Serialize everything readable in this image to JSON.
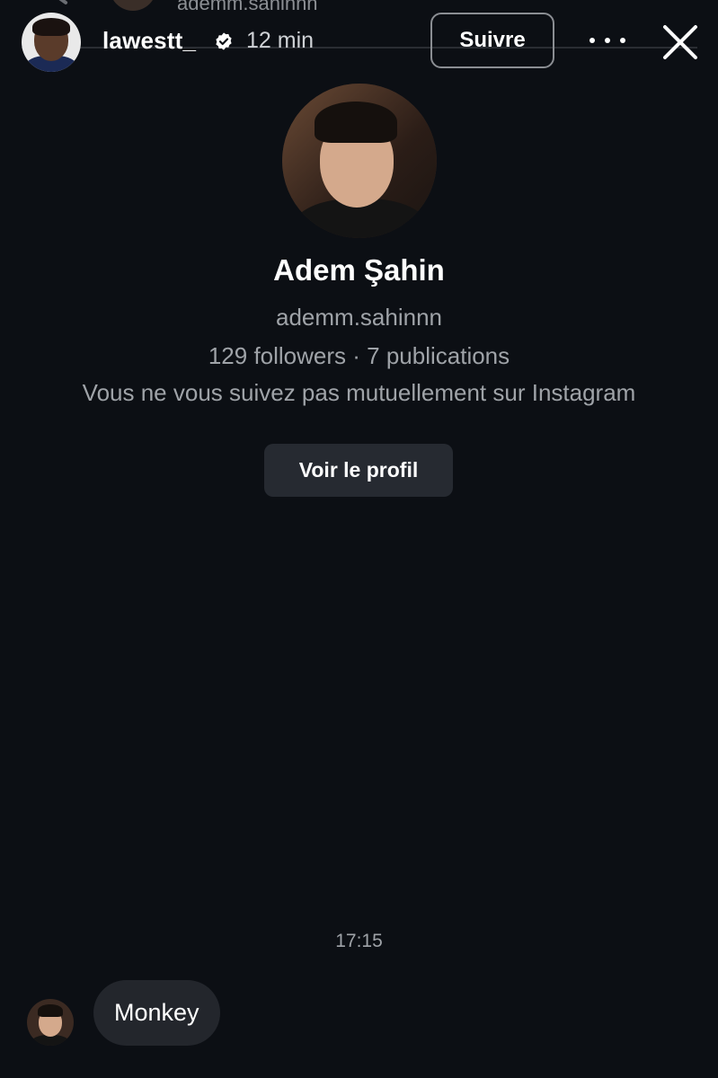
{
  "top_strip": {
    "cropped_username": "ademm.sahinnn"
  },
  "header": {
    "username": "lawestt_",
    "verified": true,
    "time": "12 min",
    "follow_label": "Suivre",
    "more_icon": "more-horizontal-icon",
    "close_icon": "close-icon"
  },
  "profile": {
    "name": "Adem Şahin",
    "handle": "ademm.sahinnn",
    "stats": "129 followers · 7 publications",
    "mutual_note": "Vous ne vous suivez pas mutuellement sur Instagram",
    "view_profile_label": "Voir le profil"
  },
  "messages": [
    {
      "timestamp": "17:15",
      "text": "Monkey"
    }
  ],
  "colors": {
    "background": "#0c0f14",
    "bubble": "#23262c",
    "button": "#262a31",
    "secondary_text": "#9fa3a8"
  }
}
